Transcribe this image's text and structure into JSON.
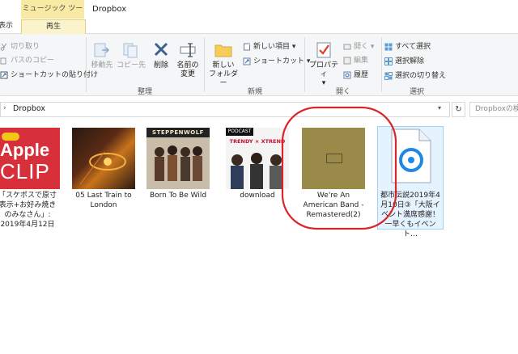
{
  "titlebar": {
    "context_tab_header": "ミュージック ツール",
    "window_title": "Dropbox"
  },
  "tabs": {
    "partial_left": "表示",
    "play": "再生"
  },
  "ribbon": {
    "clipboard": {
      "cut": "切り取り",
      "copy_path": "パスのコピー",
      "paste_shortcut": "ショートカットの貼り付け"
    },
    "organize": {
      "move_to": "移動先",
      "copy_to": "コピー先",
      "delete": "削除",
      "rename_line1": "名前の",
      "rename_line2": "変更",
      "group_label": "整理"
    },
    "new": {
      "new_folder_line1": "新しい",
      "new_folder_line2": "フォルダー",
      "new_item": "新しい項目",
      "shortcut": "ショートカット",
      "group_label": "新規"
    },
    "open": {
      "properties": "プロパティ",
      "open": "開く",
      "edit": "編集",
      "history": "履歴",
      "group_label": "開く"
    },
    "select": {
      "select_all": "すべて選択",
      "select_none": "選択解除",
      "invert": "選択の切り替え",
      "group_label": "選択"
    }
  },
  "address": {
    "path": "Dropbox",
    "search_placeholder": "Dropboxの検"
  },
  "files": [
    {
      "caption": "「スケポスで原寸表示+お好み焼きのみなさん」: 2019年4月12日",
      "thumb_text_1": "Apple",
      "thumb_text_2": "CLIP"
    },
    {
      "caption": "05 Last Train to London"
    },
    {
      "caption": "Born To Be Wild",
      "thumb_text_1": "STEPPENWOLF"
    },
    {
      "caption": "download",
      "thumb_text_1": "PODCAST",
      "thumb_text_2": "TRENDY × XTREND"
    },
    {
      "caption": "We're An American Band - Remastered(2)"
    },
    {
      "caption": "都市伝説2019年4月10日③「大阪イベント満席感謝！一早くもイベント…"
    }
  ],
  "colors": {
    "context_tab": "#f8e9a3",
    "selection": "#e5f3ff",
    "selection_border": "#99d1ff",
    "annotation": "#d9262b"
  }
}
